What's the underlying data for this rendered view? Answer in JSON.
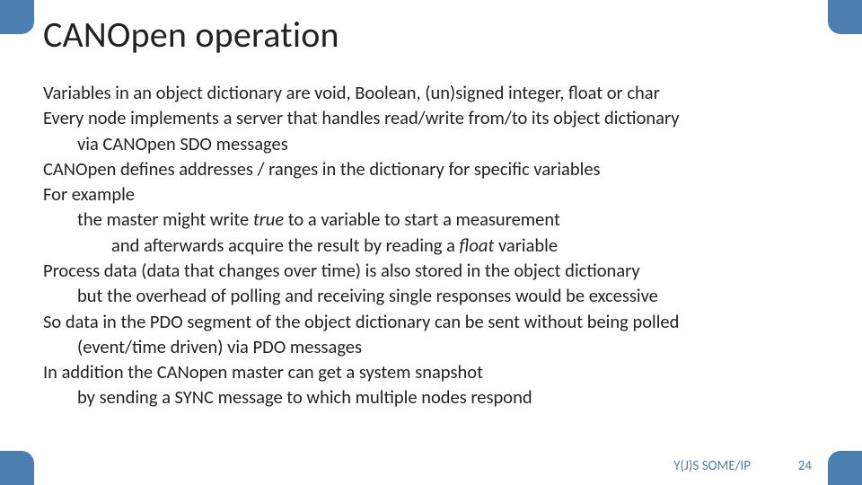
{
  "slide": {
    "title": "CANOpen operation",
    "lines": {
      "l0": "Variables in an object dictionary are void, Boolean, (un)signed integer, float or char",
      "l1": "Every node implements a server that handles read/write from/to its object dictionary",
      "l1a": "via CANOpen SDO messages",
      "l2": "CANOpen defines addresses / ranges in the dictionary for specific variables",
      "l3": "For example",
      "l3a_pre": "the master might write ",
      "l3a_em": "true",
      "l3a_post": " to a variable to start a measurement",
      "l3b_pre": "and afterwards acquire the result by reading a ",
      "l3b_em": "float",
      "l3b_post": " variable",
      "l4": "Process data (data that changes over time) is also stored in the object dictionary",
      "l4a": "but the overhead of polling and receiving single responses would be excessive",
      "l5": "So data in the PDO segment of the object dictionary can be sent without being polled",
      "l5a": "(event/time driven) via PDO messages",
      "l6": "In addition the CANopen master can get a system snapshot",
      "l6a": "by sending a SYNC message to which multiple nodes respond"
    }
  },
  "footer": {
    "tag": "Y(J)S  SOME/IP",
    "page": "24"
  }
}
